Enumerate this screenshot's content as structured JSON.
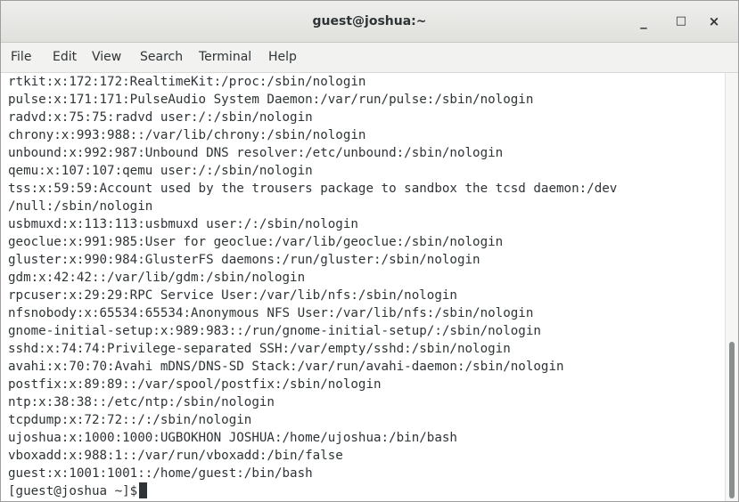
{
  "window": {
    "title": "guest@joshua:~",
    "controls": {
      "minimize": "_",
      "maximize": "□",
      "close": "×"
    }
  },
  "menubar": {
    "items": [
      "File",
      "Edit",
      "View",
      "Search",
      "Terminal",
      "Help"
    ]
  },
  "terminal": {
    "lines": [
      "rtkit:x:172:172:RealtimeKit:/proc:/sbin/nologin",
      "pulse:x:171:171:PulseAudio System Daemon:/var/run/pulse:/sbin/nologin",
      "radvd:x:75:75:radvd user:/:/sbin/nologin",
      "chrony:x:993:988::/var/lib/chrony:/sbin/nologin",
      "unbound:x:992:987:Unbound DNS resolver:/etc/unbound:/sbin/nologin",
      "qemu:x:107:107:qemu user:/:/sbin/nologin",
      "tss:x:59:59:Account used by the trousers package to sandbox the tcsd daemon:/dev",
      "/null:/sbin/nologin",
      "usbmuxd:x:113:113:usbmuxd user:/:/sbin/nologin",
      "geoclue:x:991:985:User for geoclue:/var/lib/geoclue:/sbin/nologin",
      "gluster:x:990:984:GlusterFS daemons:/run/gluster:/sbin/nologin",
      "gdm:x:42:42::/var/lib/gdm:/sbin/nologin",
      "rpcuser:x:29:29:RPC Service User:/var/lib/nfs:/sbin/nologin",
      "nfsnobody:x:65534:65534:Anonymous NFS User:/var/lib/nfs:/sbin/nologin",
      "gnome-initial-setup:x:989:983::/run/gnome-initial-setup/:/sbin/nologin",
      "sshd:x:74:74:Privilege-separated SSH:/var/empty/sshd:/sbin/nologin",
      "avahi:x:70:70:Avahi mDNS/DNS-SD Stack:/var/run/avahi-daemon:/sbin/nologin",
      "postfix:x:89:89::/var/spool/postfix:/sbin/nologin",
      "ntp:x:38:38::/etc/ntp:/sbin/nologin",
      "tcpdump:x:72:72::/:/sbin/nologin",
      "ujoshua:x:1000:1000:UGBOKHON JOSHUA:/home/ujoshua:/bin/bash",
      "vboxadd:x:988:1::/var/run/vboxadd:/bin/false",
      "guest:x:1001:1001::/home/guest:/bin/bash"
    ],
    "prompt": "[guest@joshua ~]$"
  }
}
